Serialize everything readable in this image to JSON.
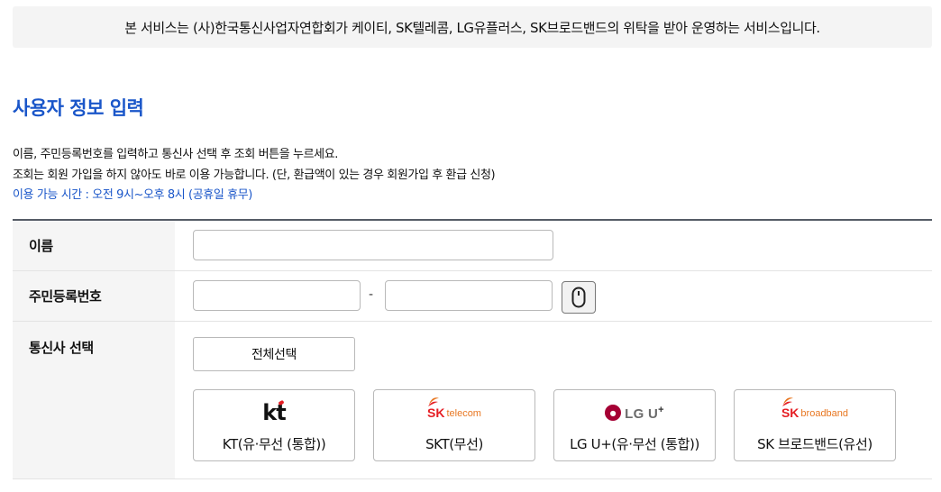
{
  "notice": {
    "text": "본 서비스는 (사)한국통신사업자연합회가 케이티, SK텔레콤, LG유플러스, SK브로드밴드의 위탁을 받아 운영하는 서비스입니다."
  },
  "section": {
    "title": "사용자 정보 입력",
    "desc1": "이름, 주민등록번호를 입력하고 통신사 선택 후 조회 버튼을 누르세요.",
    "desc2": "조회는 회원 가입을 하지 않아도 바로 이용 가능합니다. (단, 환급액이 있는 경우 회원가입 후 환급 신청)",
    "hours": "이용 가능 시간 : 오전 9시~오후 8시 (공휴일 휴무)"
  },
  "form": {
    "name_label": "이름",
    "name_value": "",
    "ssn_label": "주민등록번호",
    "ssn_first": "",
    "ssn_dash": "-",
    "ssn_second": "",
    "keyboard_icon": "mouse-icon",
    "carrier_label": "통신사 선택",
    "select_all": "전체선택",
    "carriers": [
      {
        "name": "KT(유·무선 (통합))",
        "logo": "kt",
        "logo_text": "kt"
      },
      {
        "name": "SKT(무선)",
        "logo": "SK telecom",
        "logo_sk": "SK",
        "logo_sub": "telecom"
      },
      {
        "name": "LG U+(유·무선 (통합))",
        "logo": "LG U+",
        "logo_main": "LG U",
        "logo_sup": "+"
      },
      {
        "name": "SK 브로드밴드(유선)",
        "logo": "SK broadband",
        "logo_sk": "SK",
        "logo_sub": "broadband"
      }
    ]
  },
  "colors": {
    "accent": "#1a56c9",
    "sk_red": "#e51e24",
    "sk_orange": "#e87722",
    "lg_red": "#a50034"
  }
}
